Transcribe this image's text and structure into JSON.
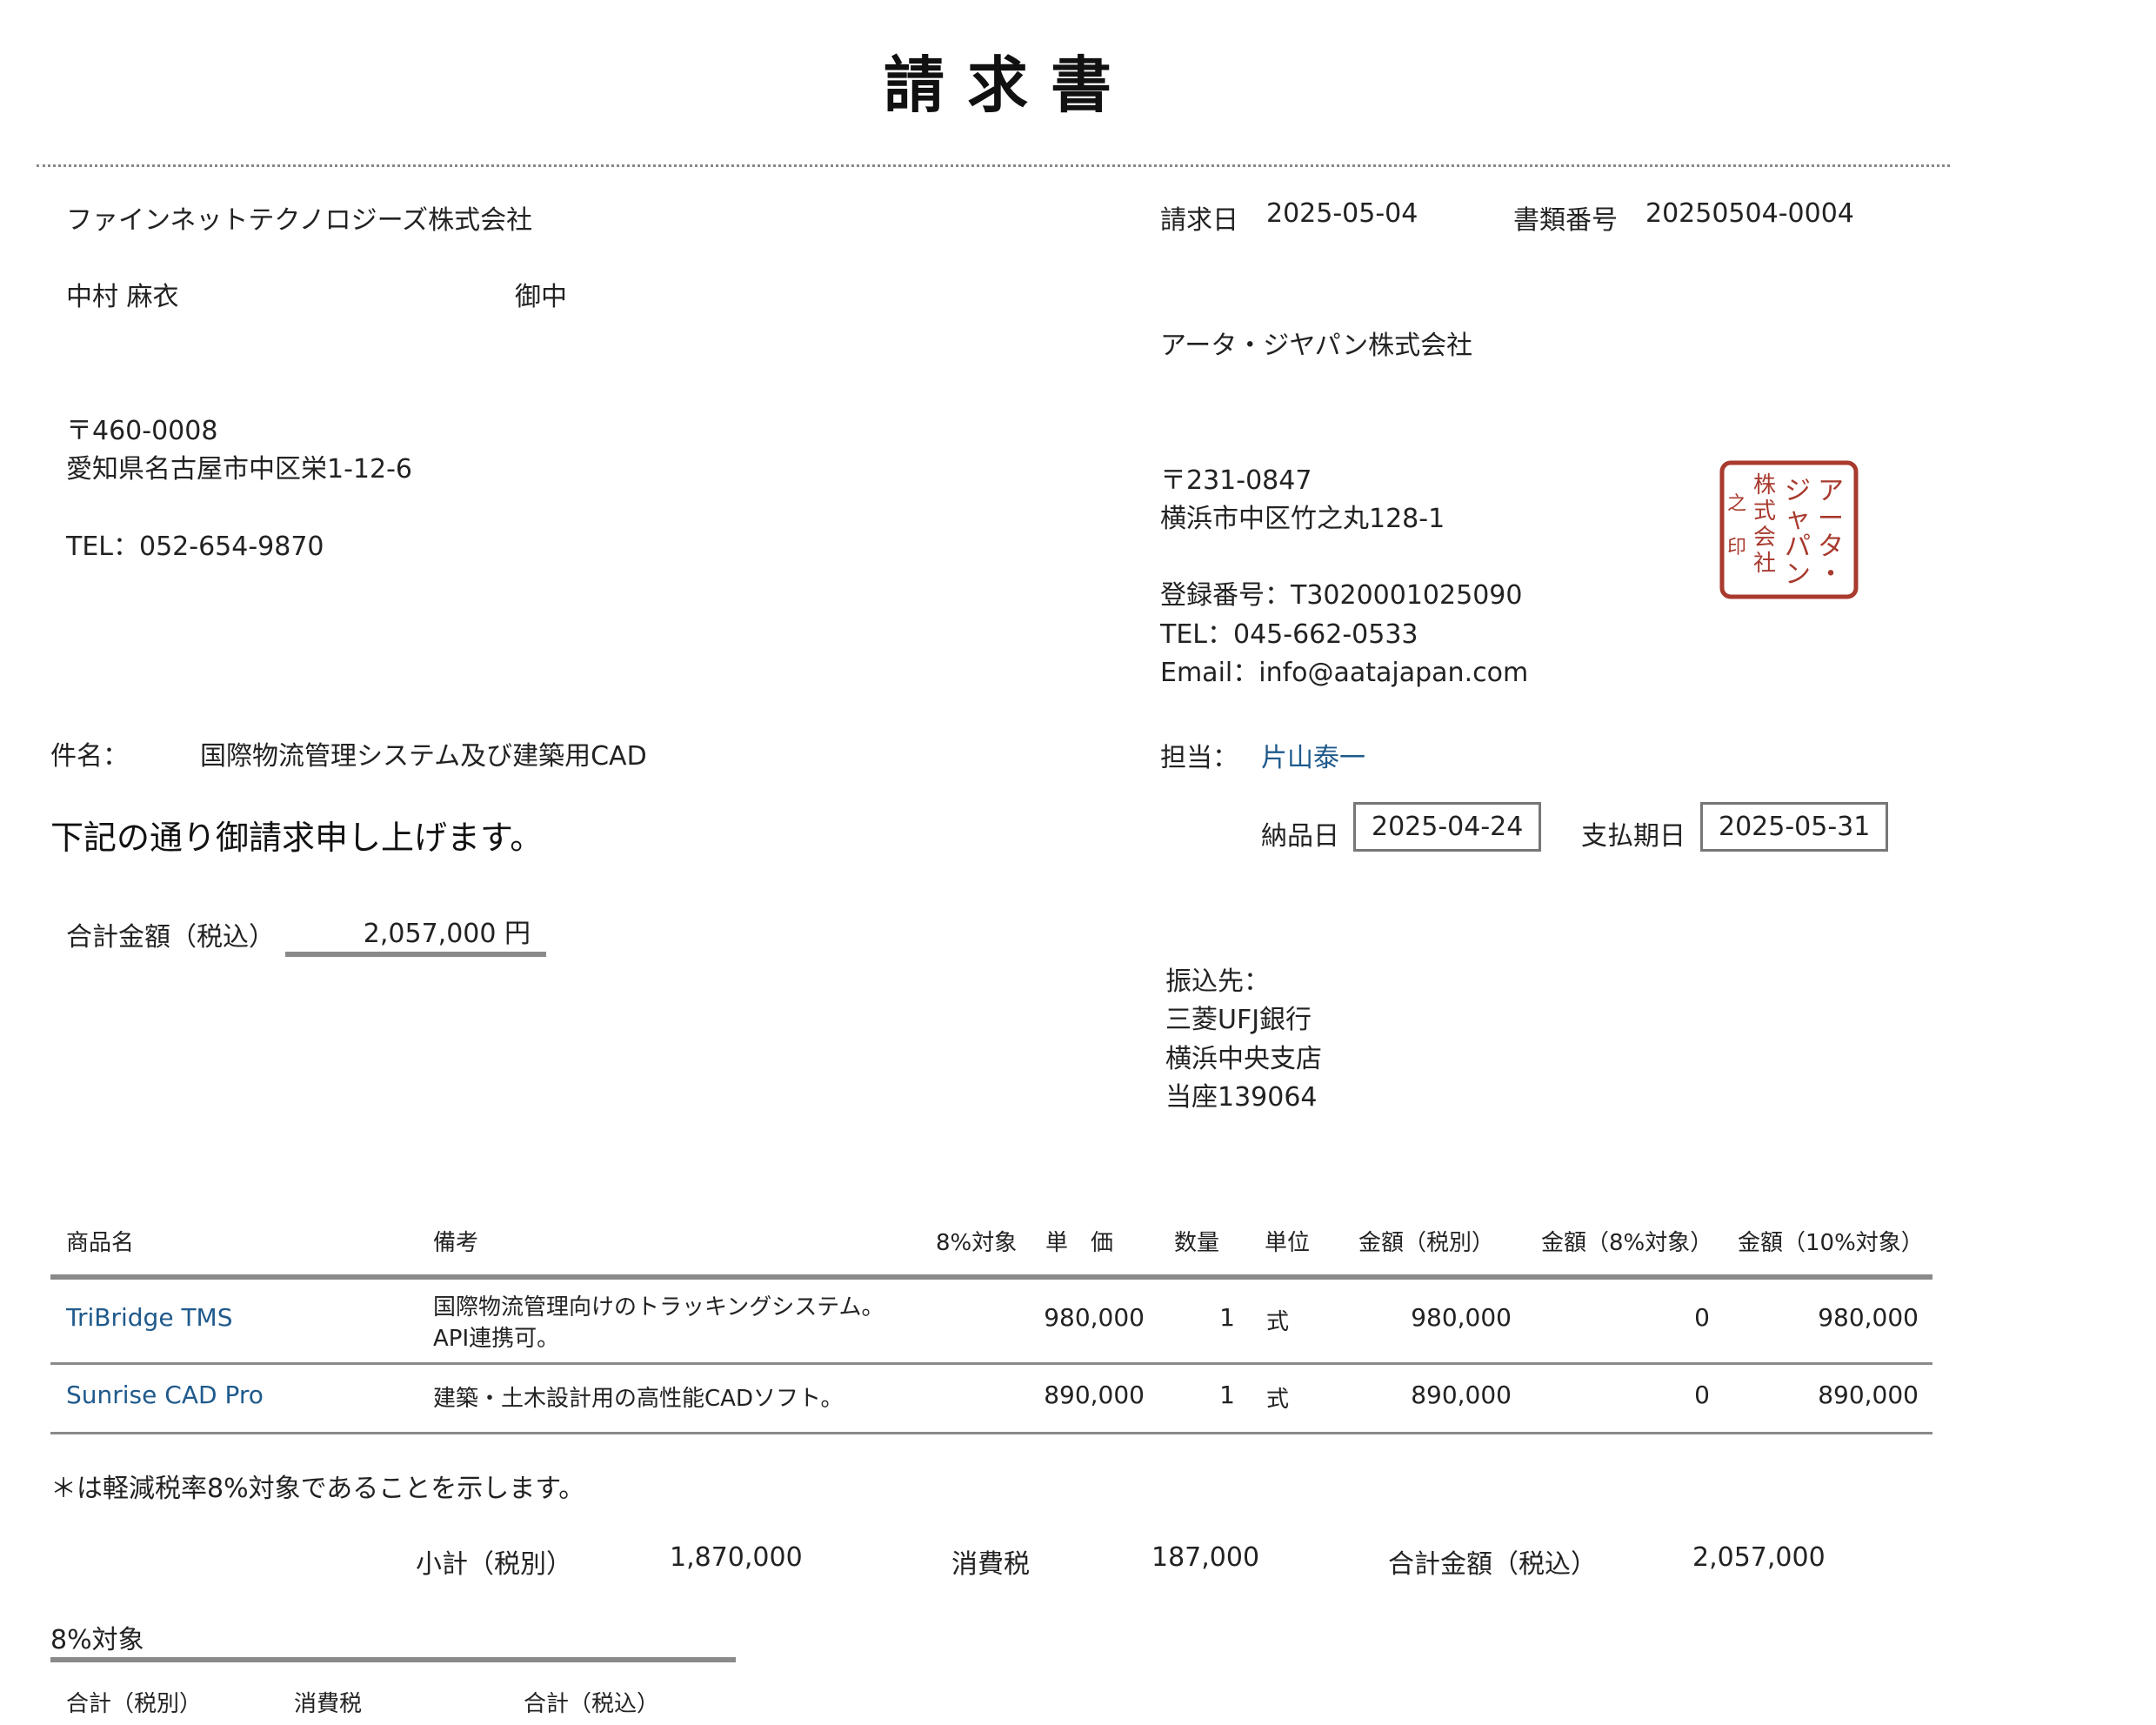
{
  "document": {
    "title": "請求書"
  },
  "recipient": {
    "company": "ファインネットテクノロジーズ株式会社",
    "person": "中村 麻衣",
    "honorific": "御中",
    "postal": "〒460-0008",
    "address": "愛知県名古屋市中区栄1-12-6",
    "tel": "TEL：052-654-9870"
  },
  "invoice": {
    "date_label": "請求日",
    "date": "2025-05-04",
    "docno_label": "書類番号",
    "docno": "20250504-0004"
  },
  "issuer": {
    "company": "アータ・ジヤパン株式会社",
    "postal": "〒231-0847",
    "address": "横浜市中区竹之丸128-1",
    "reg": "登録番号：T3020001025090",
    "tel": "TEL：045-662-0533",
    "email": "Email：info@aatajapan.com",
    "stamp_text": "アータ・ジャパン株式会社"
  },
  "subject": {
    "label": "件名：",
    "value": "国際物流管理システム及び建築用CAD"
  },
  "staff": {
    "label": "担当：",
    "value": "片山泰一"
  },
  "message": "下記の通り御請求申し上げます。",
  "dates": {
    "delivery_label": "納品日",
    "delivery": "2025-04-24",
    "due_label": "支払期日",
    "due": "2025-05-31"
  },
  "total": {
    "label": "合計金額（税込）",
    "value": "2,057,000 円"
  },
  "bank": {
    "label": "振込先：",
    "name": "三菱UFJ銀行",
    "branch": "横浜中央支店",
    "account": "当座139064"
  },
  "table": {
    "headers": {
      "name": "商品名",
      "note": "備考",
      "eight": "8%対象",
      "price": "単　価",
      "qty": "数量",
      "unit": "単位",
      "amount": "金額（税別）",
      "amount8": "金額（8%対象）",
      "amount10": "金額（10%対象）"
    },
    "rows": [
      {
        "name": "TriBridge TMS",
        "note1": "国際物流管理向けのトラッキングシステム。",
        "note2": "API連携可。",
        "price": "980,000",
        "qty": "1",
        "unit": "式",
        "amount": "980,000",
        "amount8": "0",
        "amount10": "980,000"
      },
      {
        "name": "Sunrise CAD Pro",
        "note1": "建築・土木設計用の高性能CADソフト。",
        "note2": "",
        "price": "890,000",
        "qty": "1",
        "unit": "式",
        "amount": "890,000",
        "amount8": "0",
        "amount10": "890,000"
      }
    ]
  },
  "footnote": "＊は軽減税率8%対象であることを示します。",
  "summary": {
    "subtotal_label": "小計（税別）",
    "subtotal": "1,870,000",
    "tax_label": "消費税",
    "tax": "187,000",
    "total_label": "合計金額（税込）",
    "total": "2,057,000"
  },
  "eight": {
    "title": "8%対象",
    "col1": "合計（税別）",
    "col2": "消費税",
    "col3": "合計（税込）"
  }
}
